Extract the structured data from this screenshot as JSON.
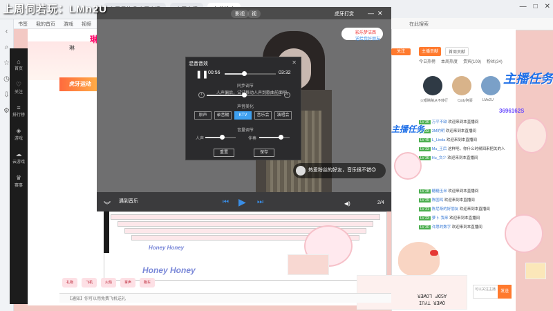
{
  "overlay": {
    "watermark": "上周伺若玩：LMn2U"
  },
  "browser": {
    "tabs": [
      "上周伺若玩 虎牙直播",
      "虎牙直播",
      "在此搜索"
    ],
    "search_placeholder": "在此搜索",
    "bookmarks": [
      "书签",
      "我的首页",
      "游戏",
      "视频",
      "购物"
    ],
    "controls": [
      "—",
      "□",
      "✕"
    ]
  },
  "stream": {
    "anchor_name": "琳",
    "brand": "琳",
    "ad_banner": "虎牙运动",
    "nav_items": [
      "首页",
      "关注",
      "排行榜",
      "游戏",
      "云游戏",
      "赛事"
    ],
    "video_title_btn": "影视",
    "video_title_btn2": "视",
    "video_top_right": "虎牙打赏",
    "donate_line1": "影乐梦洁西",
    "donate_line2": "送给我好朋友",
    "bottom_left": "遇到音乐",
    "comment_text": "热爱粉丝的好友，音乐很不错😊",
    "bottom_right": "2/4",
    "tab_bottom": "【通知】你可以用免费飞机送礼",
    "gifts": [
      "礼物",
      "飞机",
      "火箭",
      "掌声",
      "跑车"
    ]
  },
  "dialog": {
    "title": "混音音效",
    "current_time": "00:56",
    "total_time": "03:32",
    "sync_label": "同步调节",
    "tip": "人声偏后，试试移动人声到歌曲前面吧",
    "effect_label": "声音美化",
    "effects": [
      "原声",
      "录音棚",
      "KTV",
      "音乐会",
      "演唱会"
    ],
    "active_effect": "KTV",
    "volume_label": "音量调节",
    "voice_label": "人声",
    "accomp_label": "伴奏",
    "reset_btn": "重置",
    "save_btn": "保存",
    "progress": 0.38,
    "sync_value": 0.5,
    "voice_value": 0.55,
    "accomp_value": 0.7
  },
  "chat": {
    "search_placeholder": "在此搜索",
    "follow": "关注",
    "tabs": [
      "主播贡献",
      "首周贡献"
    ],
    "fan_row": [
      "今日热榜",
      "本周热度",
      "贵宾(109)",
      "粉丝(34)"
    ],
    "ranks": [
      "火眼睛睛从不转行",
      "Cody阿豪",
      "LMn2U"
    ],
    "messages": [
      {
        "lv": "LV 36",
        "name": "万平不缺",
        "text": "欢迎来到本直播间"
      },
      {
        "lv": "LV 33",
        "name": "3M的明",
        "text": "欢迎来到本直播间"
      },
      {
        "lv": "LV 45",
        "name": "L_Linda",
        "text": "欢迎来到本直播间"
      },
      {
        "lv": "LV 33",
        "name": "Mu_王后",
        "text": "这样吧，你什么时候回来把关的人"
      },
      {
        "lv": "LV 36",
        "name": "Hu_文少",
        "text": "欢迎来到本直播间"
      },
      {
        "lv": "LV 28",
        "name": "糖糖玉米",
        "text": "欢迎来到本直播间"
      },
      {
        "lv": "LV 29",
        "name": "陈国鸡",
        "text": "欢迎来到本直播间"
      },
      {
        "lv": "LV 31",
        "name": "陈尼斯的好朋友",
        "text": "欢迎来到本直播间"
      },
      {
        "lv": "LV 23",
        "name": "萝卜·我来",
        "text": "欢迎来到本直播间"
      },
      {
        "lv": "LV 30",
        "name": "许愿的数字",
        "text": "欢迎来到本直播间"
      }
    ],
    "number": "3696162S",
    "input_placeholder": "可以关注主播",
    "send": "发送"
  },
  "stickers": {
    "zhujiang": "主播任务",
    "honey": "Honey Honey",
    "honey_small": "Honey Honey",
    "keyboard1": "ASDF LOWER",
    "keyboard2": "QWER TYUI"
  }
}
